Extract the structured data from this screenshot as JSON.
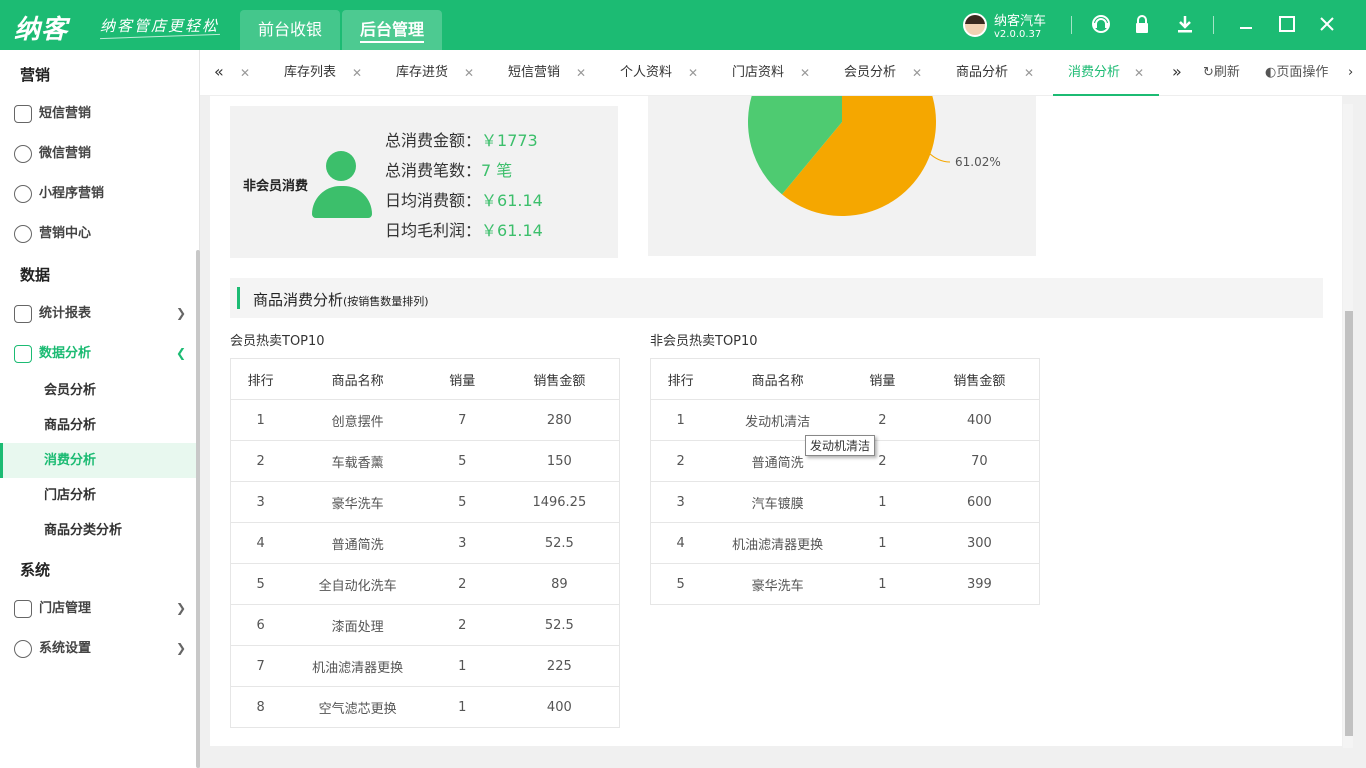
{
  "app": {
    "logo": "纳客",
    "slogan": "纳客管店更轻松",
    "nav": [
      "前台收银",
      "后台管理"
    ],
    "user_name": "纳客汽车",
    "version": "v2.0.0.37"
  },
  "sidebar": {
    "sections": [
      {
        "title": "营销"
      },
      {
        "title": "数据"
      },
      {
        "title": "系统"
      }
    ],
    "marketing": [
      "短信营销",
      "微信营销",
      "小程序营销",
      "营销中心"
    ],
    "data_items": [
      "统计报表",
      "数据分析"
    ],
    "analysis_sub": [
      "会员分析",
      "商品分析",
      "消费分析",
      "门店分析",
      "商品分类分析"
    ],
    "system_items": [
      "门店管理",
      "系统设置"
    ]
  },
  "tabs": {
    "items": [
      "库存列表",
      "库存进货",
      "短信营销",
      "个人资料",
      "门店资料",
      "会员分析",
      "商品分析",
      "消费分析"
    ],
    "active": "消费分析",
    "refresh": "刷新",
    "page_ops": "页面操作"
  },
  "non_member": {
    "title": "非会员消费",
    "stats": [
      {
        "label": "总消费金额：",
        "value": "￥1773"
      },
      {
        "label": "总消费笔数：",
        "value": "7 笔"
      },
      {
        "label": "日均消费额：",
        "value": "￥61.14"
      },
      {
        "label": "日均毛利润：",
        "value": "￥61.14"
      }
    ]
  },
  "chart_data": {
    "type": "pie",
    "slices": [
      {
        "value": 61.02,
        "color": "#f5a700"
      },
      {
        "value": 38.98,
        "color": "#4ecb71"
      }
    ],
    "labels": [
      "61.02%"
    ]
  },
  "section": {
    "title": "商品消费分析",
    "subtitle": "(按销售数量排列)"
  },
  "member_table": {
    "title": "会员热卖TOP10",
    "headers": [
      "排行",
      "商品名称",
      "销量",
      "销售金额"
    ],
    "rows": [
      [
        "1",
        "创意摆件",
        "7",
        "280"
      ],
      [
        "2",
        "车载香薰",
        "5",
        "150"
      ],
      [
        "3",
        "豪华洗车",
        "5",
        "1496.25"
      ],
      [
        "4",
        "普通简洗",
        "3",
        "52.5"
      ],
      [
        "5",
        "全自动化洗车",
        "2",
        "89"
      ],
      [
        "6",
        "漆面处理",
        "2",
        "52.5"
      ],
      [
        "7",
        "机油滤清器更换",
        "1",
        "225"
      ],
      [
        "8",
        "空气滤芯更换",
        "1",
        "400"
      ]
    ]
  },
  "nonmember_table": {
    "title": "非会员热卖TOP10",
    "headers": [
      "排行",
      "商品名称",
      "销量",
      "销售金额"
    ],
    "rows": [
      [
        "1",
        "发动机清洁",
        "2",
        "400"
      ],
      [
        "2",
        "普通简洗",
        "2",
        "70"
      ],
      [
        "3",
        "汽车镀膜",
        "1",
        "600"
      ],
      [
        "4",
        "机油滤清器更换",
        "1",
        "300"
      ],
      [
        "5",
        "豪华洗车",
        "1",
        "399"
      ]
    ]
  },
  "tooltip": "发动机清洁",
  "colors": {
    "brand": "#1cbb73",
    "accent_green": "#3cbf6b",
    "pie_orange": "#f5a700",
    "pie_green": "#4ecb71"
  }
}
